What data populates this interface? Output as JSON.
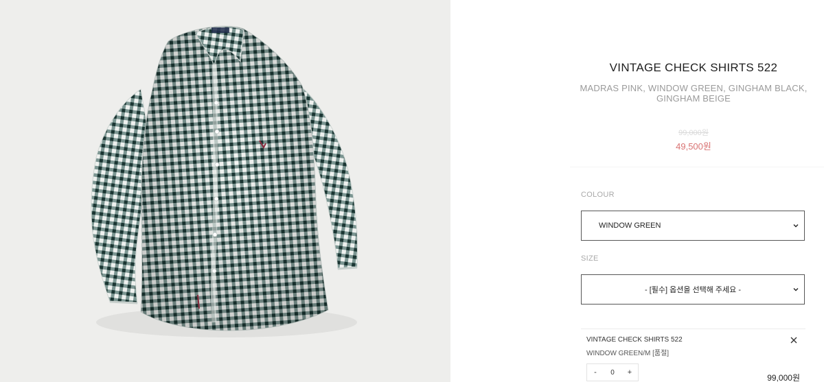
{
  "product": {
    "image_alt": "green and white gingham check long-sleeve shirt",
    "title": "VINTAGE CHECK SHIRTS 522",
    "colors_line": "MADRAS PINK, WINDOW GREEN, GINGHAM BLACK, GINGHAM BEIGE",
    "price_original": "99,000원",
    "price_sale": "49,500원"
  },
  "options": {
    "colour_label": "COLOUR",
    "colour_selected": "WINDOW GREEN",
    "size_label": "SIZE",
    "size_selected": "- [필수] 옵션을 선택해 주세요 -",
    "dropdown_icon": "chevron-down-icon"
  },
  "cart_item": {
    "name": "VINTAGE CHECK SHIRTS 522",
    "option": "WINDOW GREEN/M [품절]",
    "quantity": "0",
    "minus": "-",
    "plus": "+",
    "price": "99,000원",
    "remove_icon": "close-icon"
  },
  "colors": {
    "sale_price": "#d97373",
    "photo_background": "#eeeeec",
    "shirt_check_dark": "#1f4a45",
    "shirt_check_light": "#ffffff"
  }
}
